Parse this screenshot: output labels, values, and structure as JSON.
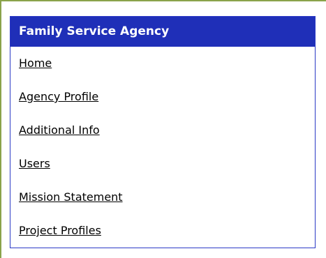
{
  "nav": {
    "title": "Family Service Agency",
    "items": [
      {
        "label": "Home"
      },
      {
        "label": "Agency Profile"
      },
      {
        "label": "Additional Info"
      },
      {
        "label": "Users"
      },
      {
        "label": "Mission Statement"
      },
      {
        "label": "Project Profiles"
      }
    ]
  },
  "colors": {
    "header_bg": "#1f2fb8",
    "box_border": "#2b39c6",
    "frame": "#8aa34a",
    "link": "#000000"
  }
}
